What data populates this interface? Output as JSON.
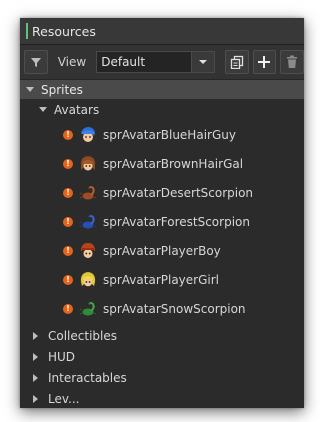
{
  "panel": {
    "title": "Resources",
    "accent_color": "#5ec27a"
  },
  "toolbar": {
    "filter_icon": "funnel-icon",
    "view_label": "View",
    "view_selected": "Default",
    "copy_icon": "duplicate-icon",
    "add_icon": "plus-icon",
    "delete_icon": "trash-icon"
  },
  "tree": {
    "root": {
      "label": "Sprites",
      "expanded": true
    },
    "group": {
      "label": "Avatars",
      "expanded": true
    },
    "sprites": [
      {
        "label": "sprAvatarBlueHairGuy",
        "icon": "blue-hair-guy-icon",
        "warning": "!"
      },
      {
        "label": "sprAvatarBrownHairGal",
        "icon": "brown-hair-gal-icon",
        "warning": "!"
      },
      {
        "label": "sprAvatarDesertScorpion",
        "icon": "desert-scorpion-icon",
        "warning": "!"
      },
      {
        "label": "sprAvatarForestScorpion",
        "icon": "forest-scorpion-icon",
        "warning": "!"
      },
      {
        "label": "sprAvatarPlayerBoy",
        "icon": "player-boy-icon",
        "warning": "!"
      },
      {
        "label": "sprAvatarPlayerGirl",
        "icon": "player-girl-icon",
        "warning": "!"
      },
      {
        "label": "sprAvatarSnowScorpion",
        "icon": "snow-scorpion-icon",
        "warning": "!"
      }
    ],
    "collapsed_groups": [
      {
        "label": "Collectibles"
      },
      {
        "label": "HUD"
      },
      {
        "label": "Interactables"
      },
      {
        "label": "Lev..."
      }
    ]
  }
}
